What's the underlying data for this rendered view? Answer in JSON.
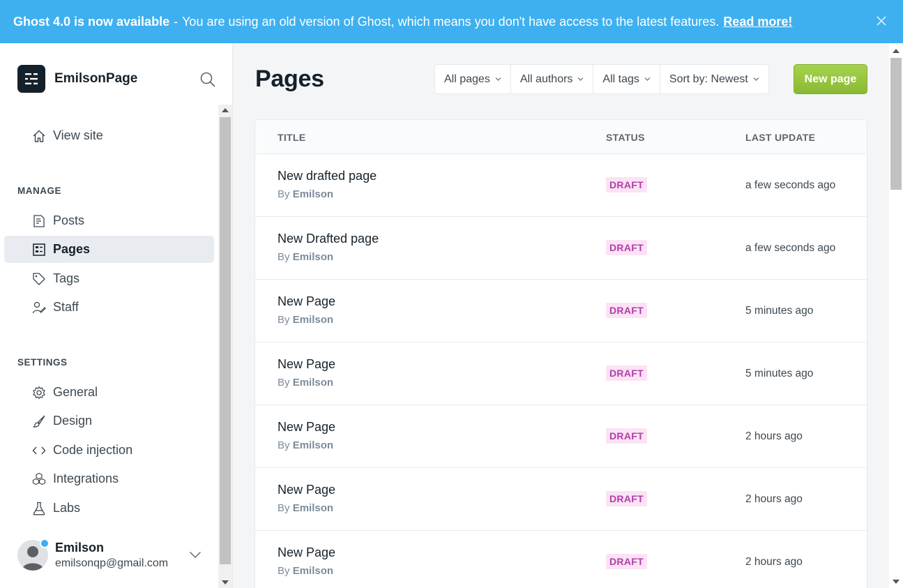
{
  "banner": {
    "strong": "Ghost 4.0 is now available",
    "separator": "-",
    "message": "You are using an old version of Ghost, which means you don't have access to the latest features.",
    "link": "Read more!",
    "bg_color": "#3eb0ef"
  },
  "sidebar": {
    "site_name": "EmilsonPage",
    "view_site": "View site",
    "manage_title": "MANAGE",
    "manage": [
      {
        "label": "Posts",
        "icon": "posts-icon"
      },
      {
        "label": "Pages",
        "icon": "pages-icon",
        "active": true
      },
      {
        "label": "Tags",
        "icon": "tag-icon"
      },
      {
        "label": "Staff",
        "icon": "staff-icon"
      }
    ],
    "settings_title": "SETTINGS",
    "settings": [
      {
        "label": "General",
        "icon": "gear-icon"
      },
      {
        "label": "Design",
        "icon": "brush-icon"
      },
      {
        "label": "Code injection",
        "icon": "code-icon"
      },
      {
        "label": "Integrations",
        "icon": "integrations-icon"
      },
      {
        "label": "Labs",
        "icon": "flask-icon"
      }
    ],
    "user": {
      "name": "Emilson",
      "email": "emilsonqp@gmail.com"
    }
  },
  "main": {
    "title": "Pages",
    "filters": [
      "All pages",
      "All authors",
      "All tags",
      "Sort by: Newest"
    ],
    "new_button": "New page",
    "accent_color": "#9fcb45",
    "table": {
      "columns": [
        "TITLE",
        "STATUS",
        "LAST UPDATE"
      ],
      "rows": [
        {
          "title": "New drafted page",
          "by": "By",
          "author": "Emilson",
          "status": "DRAFT",
          "updated": "a few seconds ago"
        },
        {
          "title": "New Drafted page",
          "by": "By",
          "author": "Emilson",
          "status": "DRAFT",
          "updated": "a few seconds ago"
        },
        {
          "title": "New Page",
          "by": "By",
          "author": "Emilson",
          "status": "DRAFT",
          "updated": "5 minutes ago"
        },
        {
          "title": "New Page",
          "by": "By",
          "author": "Emilson",
          "status": "DRAFT",
          "updated": "5 minutes ago"
        },
        {
          "title": "New Page",
          "by": "By",
          "author": "Emilson",
          "status": "DRAFT",
          "updated": "2 hours ago"
        },
        {
          "title": "New Page",
          "by": "By",
          "author": "Emilson",
          "status": "DRAFT",
          "updated": "2 hours ago"
        },
        {
          "title": "New Page",
          "by": "By",
          "author": "Emilson",
          "status": "DRAFT",
          "updated": "2 hours ago"
        }
      ]
    }
  }
}
